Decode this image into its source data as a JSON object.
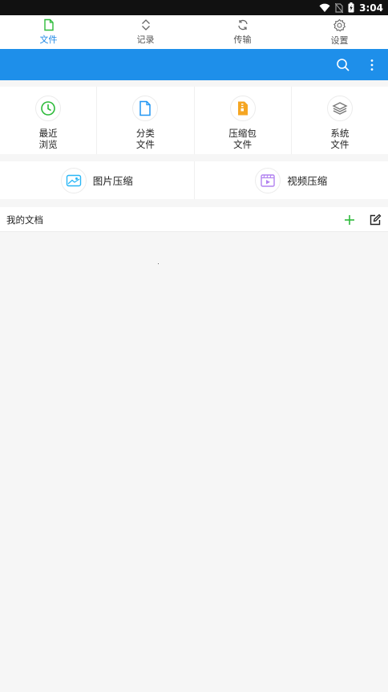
{
  "status_bar": {
    "time": "3:04"
  },
  "tabs": [
    {
      "label": "文件",
      "icon": "file-icon",
      "active": true
    },
    {
      "label": "记录",
      "icon": "updown-chevron-icon",
      "active": false
    },
    {
      "label": "传输",
      "icon": "sync-icon",
      "active": false
    },
    {
      "label": "设置",
      "icon": "gear-icon",
      "active": false
    }
  ],
  "categories": [
    {
      "label_line1": "最近",
      "label_line2": "浏览",
      "icon": "clock-icon",
      "color": "#2dbb3a"
    },
    {
      "label_line1": "分类",
      "label_line2": "文件",
      "icon": "document-icon",
      "color": "#2196f3"
    },
    {
      "label_line1": "压缩包",
      "label_line2": "文件",
      "icon": "zip-icon",
      "color": "#f5a623"
    },
    {
      "label_line1": "系统",
      "label_line2": "文件",
      "icon": "layers-icon",
      "color": "#888888"
    }
  ],
  "compress": [
    {
      "label": "图片压缩",
      "icon": "image-icon",
      "color": "#29b6f6"
    },
    {
      "label": "视频压缩",
      "icon": "video-icon",
      "color": "#b283f0"
    }
  ],
  "docs": {
    "title": "我的文档"
  },
  "colors": {
    "accent": "#1e88e5",
    "toolbar": "#1e8fea",
    "add": "#2dbb3a"
  }
}
